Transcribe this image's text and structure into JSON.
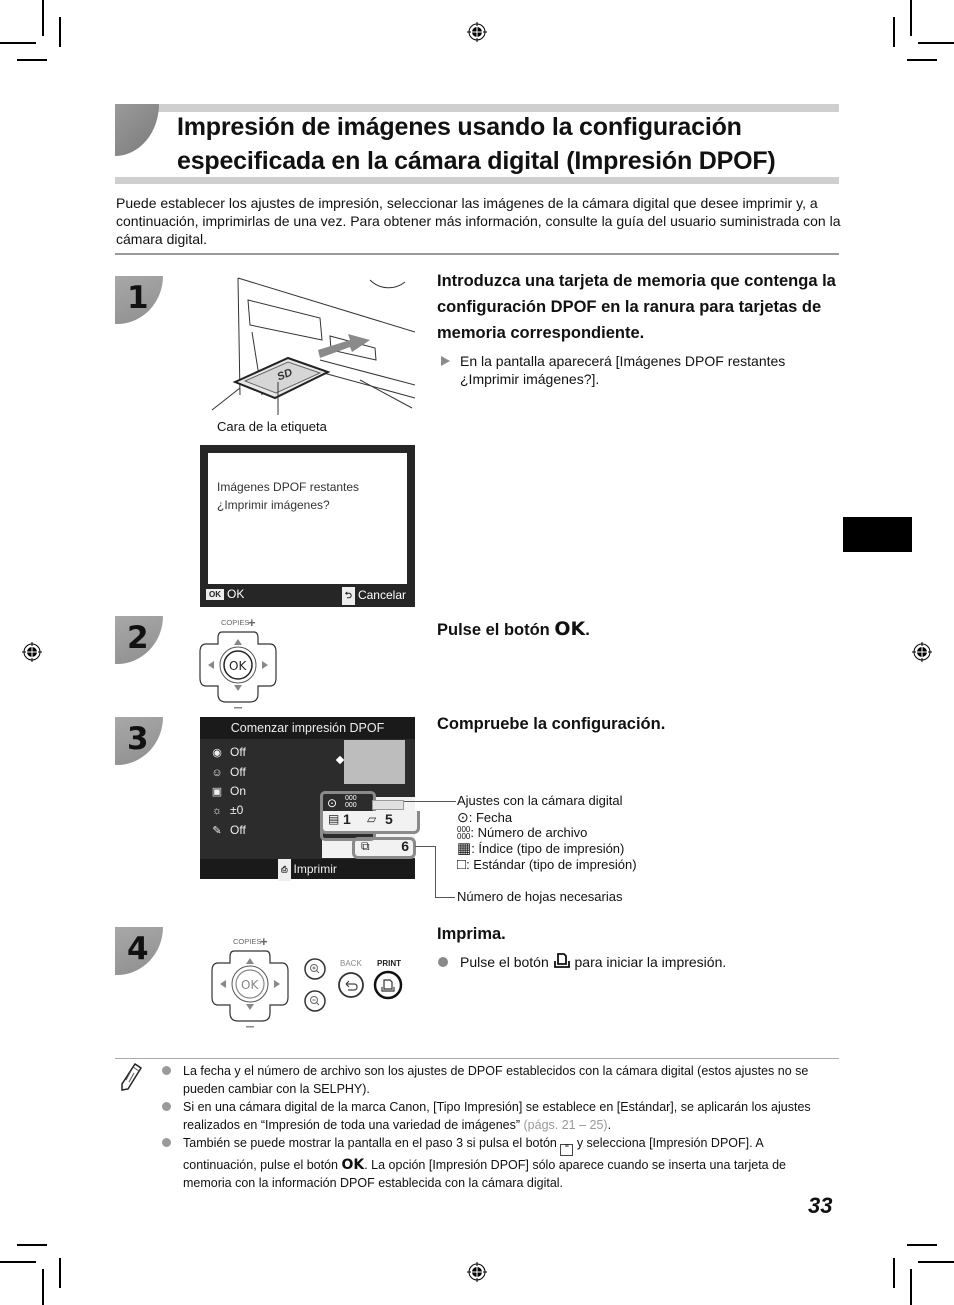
{
  "title": {
    "line1": "Impresión de imágenes usando la configuración",
    "line2": "especificada en la cámara digital (Impresión DPOF)"
  },
  "intro": "Puede establecer los ajustes de impresión, seleccionar las imágenes de la cámara digital que desee imprimir y, a continuación, imprimirlas de una vez. Para obtener más información, consulte la guía del usuario suministrada con la cámara digital.",
  "steps": [
    {
      "number": "1",
      "heading": "Introduzca una tarjeta de memoria que contenga la configuración DPOF en la ranura para tarjetas de memoria correspondiente.",
      "detail": "En la pantalla aparecerá [Imágenes DPOF restantes ¿Imprimir imágenes?].",
      "illustration_caption": "Cara de la etiqueta",
      "card_label": "SD",
      "screen": {
        "line1": "Imágenes DPOF restantes",
        "line2": "¿Imprimir imágenes?",
        "ok_key": "OK",
        "ok_label": "OK",
        "cancel_label": "Cancelar"
      }
    },
    {
      "number": "2",
      "heading_prefix": "Pulse el botón",
      "heading_button": "OK",
      "heading_suffix": ".",
      "dpad": {
        "copies_label": "COPIES",
        "plus": "+",
        "minus": "–",
        "center": "OK"
      }
    },
    {
      "number": "3",
      "heading": "Compruebe la configuración.",
      "screen": {
        "header": "Comenzar impresión DPOF",
        "settings": [
          {
            "icon": "red-eye-icon",
            "glyph": "◉",
            "value": "Off"
          },
          {
            "icon": "face-correction-icon",
            "glyph": "☺",
            "value": "Off"
          },
          {
            "icon": "image-optimize-icon",
            "glyph": "▲",
            "value": "On"
          },
          {
            "icon": "brightness-icon",
            "glyph": "☼",
            "value": "±0"
          },
          {
            "icon": "smoothing-icon",
            "glyph": "✎",
            "value": "Off"
          }
        ],
        "file_number_glyph": "000/000",
        "index_count": "1",
        "standard_count": "5",
        "sheets_count": "6",
        "footer": "Imprimir"
      },
      "callouts": {
        "settings_title": "Ajustes con la cámara digital",
        "legend": [
          {
            "icon": "clock-icon",
            "label": ": Fecha"
          },
          {
            "icon": "file-number-icon",
            "label": ": Número de archivo"
          },
          {
            "icon": "index-print-icon",
            "label": ": Índice (tipo de impresión)"
          },
          {
            "icon": "standard-print-icon",
            "label": ": Estándar (tipo de impresión)"
          }
        ],
        "sheets": "Número de hojas necesarias"
      }
    },
    {
      "number": "4",
      "heading": "Imprima.",
      "detail_prefix": "Pulse el botón",
      "detail_suffix": "para iniciar la impresión.",
      "buttons": {
        "copies_label": "COPIES",
        "back_label": "BACK",
        "print_label": "PRINT",
        "center": "OK"
      }
    }
  ],
  "notes": [
    {
      "text": "La fecha y el número de archivo son los ajustes de DPOF establecidos con la cámara digital (estos ajustes no se pueden cambiar con la SELPHY)."
    },
    {
      "text": "Si en una cámara digital de la marca Canon, [Tipo Impresión] se establece en [Estándar], se aplicarán los ajustes realizados en “Impresión de toda una variedad de imágenes”",
      "ref": "(págs. 21 – 25)",
      "end": "."
    },
    {
      "p1": "También se puede mostrar la pantalla en el paso 3 si pulsa el botón",
      "p2": "y selecciona [Impresión DPOF]. A continuación, pulse el botón",
      "ok": "OK",
      "p3": ". La opción [Impresión DPOF] sólo aparece cuando se inserta una tarjeta de memoria con la información DPOF establecida con la cámara digital."
    }
  ],
  "page_number": "33"
}
